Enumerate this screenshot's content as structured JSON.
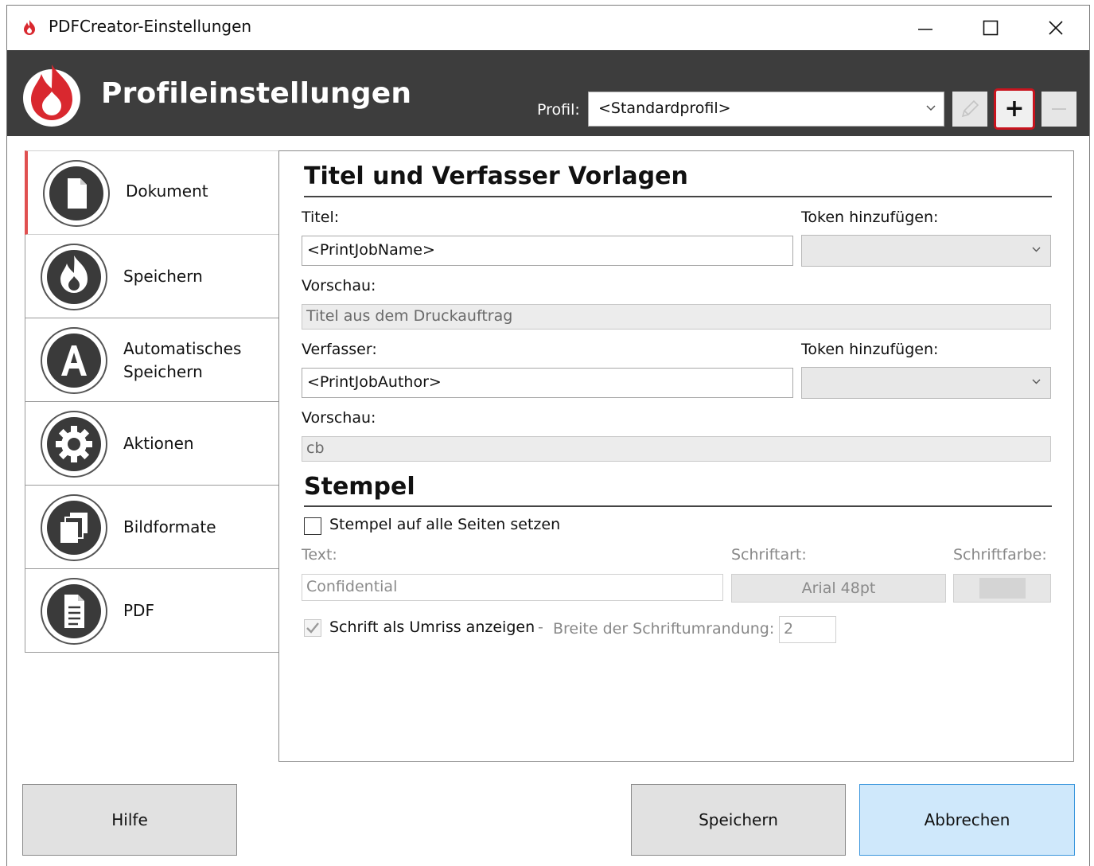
{
  "window": {
    "title": "PDFCreator-Einstellungen"
  },
  "header": {
    "heading": "Profileinstellungen",
    "profile_label": "Profil:",
    "profile_value": "<Standardprofil>",
    "add_label": "+",
    "colors": {
      "header_bg": "#3d3d3d",
      "accent": "#c8141e"
    }
  },
  "sidebar": {
    "items": [
      {
        "label": "Dokument",
        "icon": "document-icon",
        "selected": true
      },
      {
        "label": "Speichern",
        "icon": "flame-icon"
      },
      {
        "label": "Automatisches",
        "label2": "Speichern",
        "icon": "letter-a-icon"
      },
      {
        "label": "Aktionen",
        "icon": "gear-icon"
      },
      {
        "label": "Bildformate",
        "icon": "stacked-pages-icon"
      },
      {
        "label": "PDF",
        "icon": "pdf-file-icon"
      }
    ]
  },
  "content": {
    "section1_title": "Titel und Verfasser Vorlagen",
    "title_label": "Titel:",
    "title_value": "<PrintJobName>",
    "token_label_1": "Token hinzufügen:",
    "preview_label_1": "Vorschau:",
    "preview_value_1": "Titel aus dem Druckauftrag",
    "author_label": "Verfasser:",
    "author_value": "<PrintJobAuthor>",
    "token_label_2": "Token hinzufügen:",
    "preview_label_2": "Vorschau:",
    "preview_value_2": "cb",
    "section2_title": "Stempel",
    "stamp_all_pages_label": "Stempel auf alle Seiten setzen",
    "text_label": "Text:",
    "text_value": "Confidential",
    "font_label": "Schriftart:",
    "font_value": "Arial 48pt",
    "font_color_label": "Schriftfarbe:",
    "outline_label": "Schrift als Umriss anzeigen",
    "outline_dash": "-",
    "outline_width_label": "Breite der Schriftumrandung:",
    "outline_width_value": "2"
  },
  "footer": {
    "help_label": "Hilfe",
    "save_label": "Speichern",
    "cancel_label": "Abbrechen"
  }
}
